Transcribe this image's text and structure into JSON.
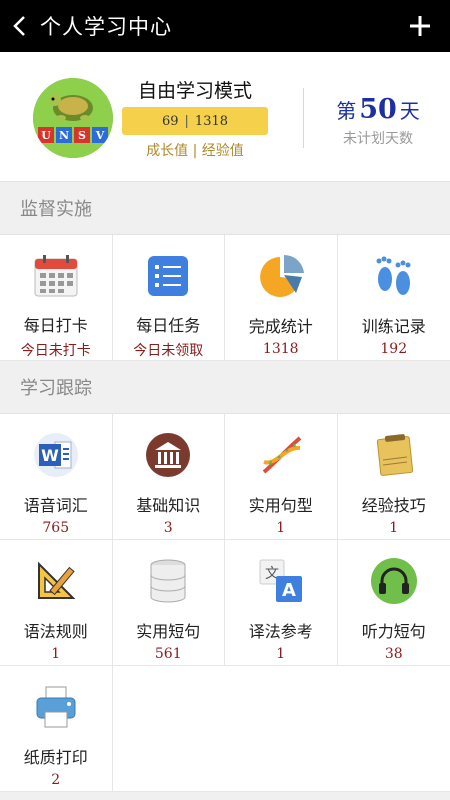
{
  "header": {
    "title": "个人学习中心"
  },
  "profile": {
    "logo_letters": [
      "U",
      "N",
      "S",
      "V"
    ],
    "mode_name": "自由学习模式",
    "growth_value": "69",
    "experience_value": "1318",
    "stats_caption": "成长值 | 经验值",
    "days_prefix": "第",
    "days_number": "50",
    "days_suffix": "天",
    "days_caption": "未计划天数"
  },
  "supervision": {
    "heading": "监督实施",
    "items": [
      {
        "label": "每日打卡",
        "value": "今日未打卡",
        "icon": "calendar-icon"
      },
      {
        "label": "每日任务",
        "value": "今日未领取",
        "icon": "checklist-icon"
      },
      {
        "label": "完成统计",
        "value": "1318",
        "icon": "pie-chart-icon"
      },
      {
        "label": "训练记录",
        "value": "192",
        "icon": "footprints-icon"
      }
    ]
  },
  "tracking": {
    "heading": "学习跟踪",
    "items": [
      {
        "label": "语音词汇",
        "value": "765",
        "icon": "word-doc-icon"
      },
      {
        "label": "基础知识",
        "value": "3",
        "icon": "library-icon"
      },
      {
        "label": "实用句型",
        "value": "1",
        "icon": "dna-icon"
      },
      {
        "label": "经验技巧",
        "value": "1",
        "icon": "notes-icon"
      },
      {
        "label": "语法规则",
        "value": "1",
        "icon": "ruler-triangle-icon"
      },
      {
        "label": "实用短句",
        "value": "561",
        "icon": "database-icon"
      },
      {
        "label": "译法参考",
        "value": "1",
        "icon": "translate-icon"
      },
      {
        "label": "听力短句",
        "value": "38",
        "icon": "headphones-icon"
      },
      {
        "label": "纸质打印",
        "value": "2",
        "icon": "printer-icon"
      }
    ]
  },
  "colors": {
    "accent_gold": "#f5d04a",
    "days_blue": "#1e2fa0",
    "value_red": "#8b1a1a"
  }
}
